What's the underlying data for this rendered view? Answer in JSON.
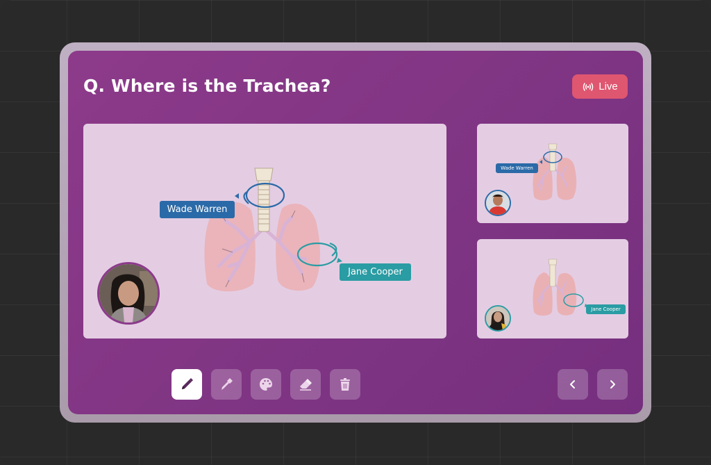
{
  "header": {
    "question": "Q. Where is the Trachea?",
    "live_button": {
      "label": "Live",
      "icon": "broadcast-icon"
    }
  },
  "main_view": {
    "diagram": "lungs-trachea-diagram",
    "annotations": [
      {
        "label": "Wade Warren",
        "color": "#2b6aa8",
        "target": "trachea"
      },
      {
        "label": "Jane Cooper",
        "color": "#2a9ca3",
        "target": "left-bronchus"
      }
    ],
    "presenter_avatar": "presenter-avatar"
  },
  "participants": [
    {
      "name": "Wade Warren",
      "annotation_label": "Wade Warren",
      "ring_color": "#2b6aa8",
      "avatar": "wade-warren-avatar"
    },
    {
      "name": "Jane Cooper",
      "annotation_label": "Jane Cooper",
      "ring_color": "#2a9ca3",
      "avatar": "jane-cooper-avatar"
    }
  ],
  "toolbar": {
    "tools": [
      {
        "id": "pencil",
        "icon": "pencil-icon",
        "active": true
      },
      {
        "id": "marker",
        "icon": "marker-icon",
        "active": false
      },
      {
        "id": "palette",
        "icon": "palette-icon",
        "active": false
      },
      {
        "id": "eraser",
        "icon": "eraser-icon",
        "active": false
      },
      {
        "id": "trash",
        "icon": "trash-icon",
        "active": false
      }
    ]
  },
  "navigation": {
    "prev": {
      "icon": "chevron-left-icon"
    },
    "next": {
      "icon": "chevron-right-icon"
    }
  },
  "colors": {
    "board": "#863888",
    "card": "#e4cde3",
    "live": "#df5670",
    "annotation_blue": "#2b6aa8",
    "annotation_teal": "#2a9ca3",
    "background": "#292929"
  }
}
